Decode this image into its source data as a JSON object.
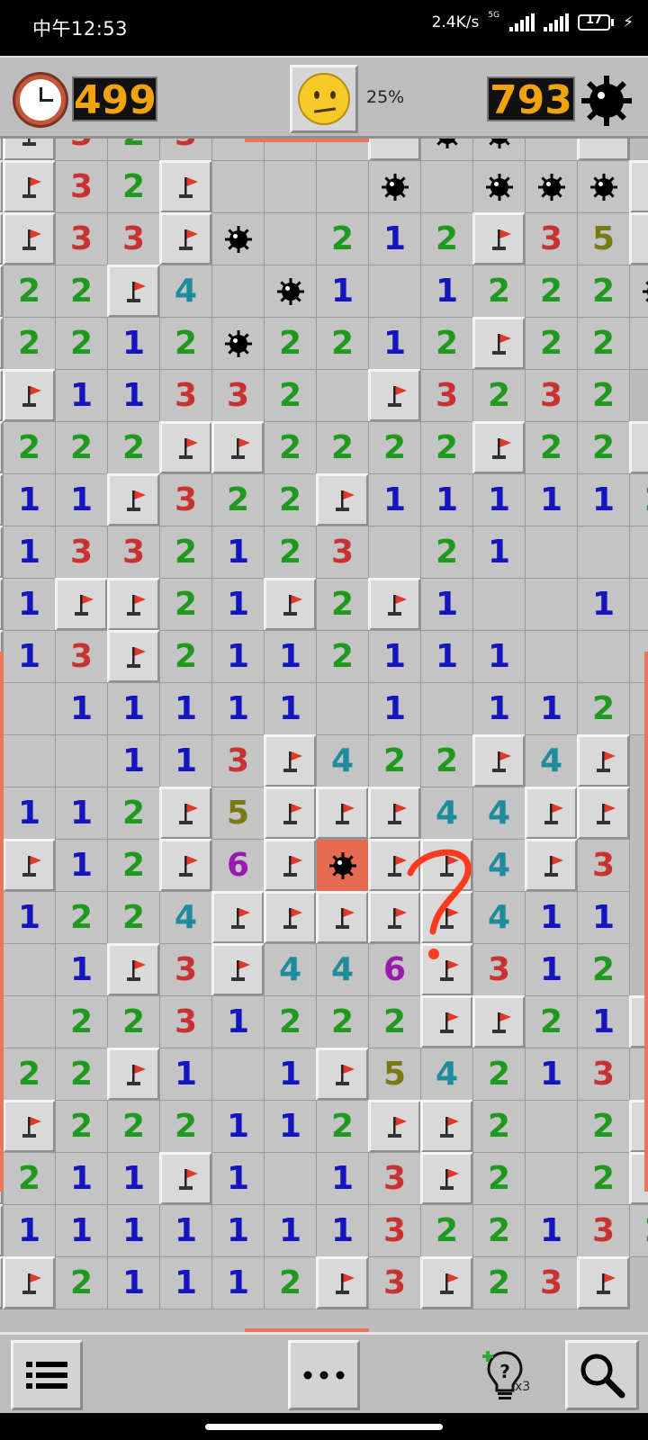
{
  "status_bar": {
    "time": "中午12:53",
    "network_speed": "2.4K/s",
    "network_type": "5G",
    "battery": "17",
    "charging": true
  },
  "header": {
    "timer": "499",
    "progress": "25%",
    "mines_left": "793",
    "face": "neutral-face"
  },
  "colors": {
    "1": "#1515c0",
    "2": "#1f9a1f",
    "3": "#c83232",
    "4": "#1e8c9c",
    "5": "#7a7a14",
    "6": "#9a1ab0",
    "explosion": "#e76b52",
    "counter_digits": "#f0a30a",
    "annotation": "#ff3b1f"
  },
  "board": {
    "legend": "F = flag, M = mine, X = exploded mine, H = hidden, digit = number, . = empty revealed",
    "rows": [
      "HF323...HMM.H",
      "HF32F...M.MMMH",
      "HF33FM.212F35H",
      "H22F4.M1.1222M",
      "H2212M2212F22.",
      "HF11332.F3232",
      "H222FF2222F22H",
      "H11F322F1111121",
      "H1332123 21..1H",
      "H1FF21F2F1..11",
      "H13F2112111...",
      "H.11111 1.1121",
      "H..113F422F4F",
      "H112F5FFF44FF",
      "HF12F6FXFF4F3",
      "H1224FFFFF411",
      "H.1F3F446F312",
      "H.2231222FF21F",
      "H22F1.1F542132",
      "HF222112FF2.2F",
      "H211F1.13F2.2F",
      "H1111111322132",
      "HF21112F3F23F"
    ]
  },
  "bottom_bar": {
    "hint_count": "x3"
  }
}
